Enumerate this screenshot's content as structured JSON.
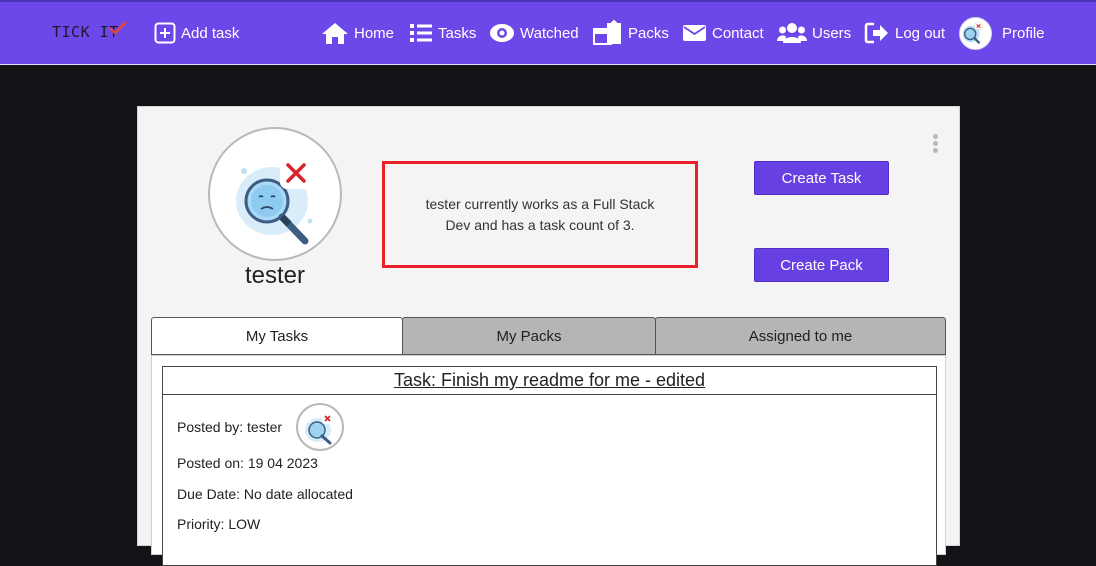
{
  "nav": {
    "brand": "TICK IT",
    "add_task": "Add task",
    "home": "Home",
    "tasks": "Tasks",
    "watched": "Watched",
    "packs": "Packs",
    "contact": "Contact",
    "users": "Users",
    "logout": "Log out",
    "profile": "Profile"
  },
  "profile": {
    "username": "tester",
    "bio": "tester currently works as a Full Stack Dev and has a task count of 3.",
    "create_task": "Create Task",
    "create_pack": "Create Pack"
  },
  "tabs": {
    "my_tasks": "My Tasks",
    "my_packs": "My Packs",
    "assigned": "Assigned to me"
  },
  "task": {
    "title": "Task: Finish my readme for me - edited",
    "posted_by": "Posted by: tester",
    "posted_on": "Posted on: 19 04 2023",
    "due_date": "Due Date: No date allocated",
    "priority": "Priority: LOW"
  },
  "colors": {
    "nav_bg": "#6c48e8",
    "accent": "#6740e4",
    "highlight_border": "#e8202a",
    "page_bg": "#141217"
  },
  "icons": [
    "add-square-icon",
    "home-icon",
    "list-icon",
    "eye-icon",
    "packs-icon",
    "envelope-icon",
    "users-icon",
    "logout-icon",
    "kebab-menu-icon"
  ]
}
